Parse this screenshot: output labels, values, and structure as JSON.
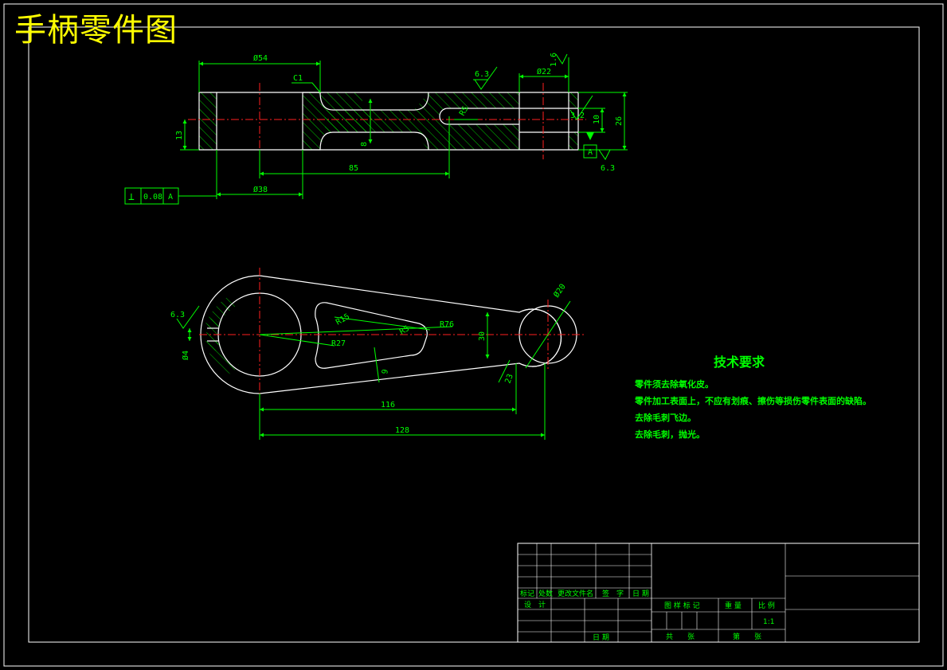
{
  "title": "手柄零件图",
  "colors": {
    "background": "#000000",
    "outline": "#ffffff",
    "dimension": "#00ff00",
    "centerline": "#ff2020",
    "title": "#ffff00"
  },
  "front_view": {
    "dims": {
      "d54": "Ø54",
      "c1": "C1",
      "rough1": "6.3",
      "rough_top": "1.6",
      "d22": "Ø22",
      "d13": "13",
      "d8": "8",
      "r5": "R5",
      "d3_2": "3.2",
      "d10": "10",
      "d26": "26",
      "datum": "A",
      "rough2": "6.3",
      "d85": "85",
      "d38": "Ø38"
    },
    "tolerance": {
      "symbol": "⊥",
      "value": "0.08",
      "datum": "A"
    }
  },
  "top_view": {
    "dims": {
      "rough": "6.3",
      "d4": "Ø4",
      "r15": "R15",
      "r27": "R27",
      "r5": "R5",
      "r76": "R76",
      "d30": "30",
      "d20": "Ø20",
      "d9": "9",
      "d23": "23",
      "d116": "116",
      "d128": "128"
    }
  },
  "requirements": {
    "heading": "技术要求",
    "items": [
      "零件须去除氧化皮。",
      "零件加工表面上，不应有划痕、擦伤等损伤零件表面的缺陷。",
      "去除毛刺飞边。",
      "去除毛刺，抛光。"
    ]
  },
  "title_block": {
    "col_mark": "标记",
    "col_count": "处数",
    "col_doc": "更改文件名",
    "col_sign": "签　字",
    "col_date": "日 期",
    "design": "设　计",
    "date": "日 期",
    "stage_mark": "图 样 标 记",
    "weight": "重 量",
    "scale_label": "比 例",
    "scale_value": "1:1",
    "sheets_total": "共　　张",
    "sheet_no": "第　　张"
  }
}
